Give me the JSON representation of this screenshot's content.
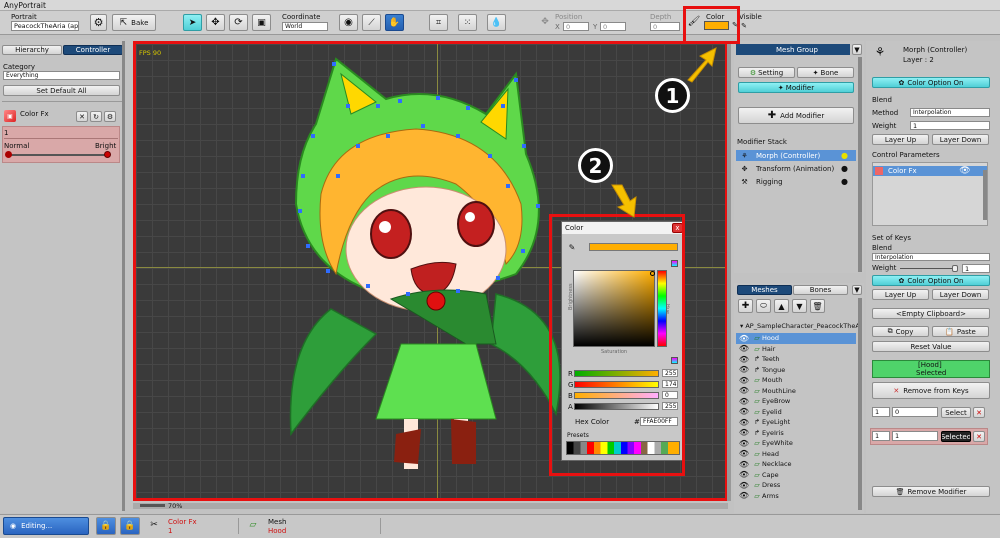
{
  "window": {
    "title": "AnyPortrait"
  },
  "toolbar": {
    "portrait_label": "Portrait",
    "portrait_value": "PeacockTheAria (ap",
    "bake_label": "Bake",
    "coordinate_label": "Coordinate",
    "coordinate_value": "World",
    "position_label": "Position",
    "pos_x_label": "X",
    "pos_x": "0",
    "pos_y_label": "Y",
    "pos_y": "0",
    "depth_label": "Depth",
    "depth_value": "0",
    "color_label": "Color",
    "visible_label": "Visible"
  },
  "left": {
    "tabs": [
      "Hierarchy",
      "Controller"
    ],
    "category_label": "Category",
    "category_value": "Everything",
    "set_default_label": "Set Default All",
    "control_name": "Color Fx",
    "control_value": "1",
    "slider_min_label": "Normal",
    "slider_max_label": "Bright"
  },
  "viewport": {
    "fps": "FPS 90",
    "zoom": "70%"
  },
  "color_picker": {
    "title": "Color",
    "close": "x",
    "brightness_label": "Brightness",
    "saturation_label": "Saturation",
    "hue_label": "Hue",
    "channels": [
      {
        "name": "R",
        "value": "255",
        "color": "#e03020"
      },
      {
        "name": "G",
        "value": "174",
        "color": "#30c030"
      },
      {
        "name": "B",
        "value": "0",
        "color": "#3050e0"
      },
      {
        "name": "A",
        "value": "255",
        "color": "#606060"
      }
    ],
    "hex_label": "Hex Color",
    "hex_hash": "#",
    "hex_value": "FFAE00FF",
    "presets_label": "Presets",
    "swatch_color": "#ffae00"
  },
  "mesh_group": {
    "header": "Mesh Group",
    "setting_label": "Setting",
    "bone_label": "Bone",
    "modifier_label": "Modifier",
    "add_modifier_label": "Add Modifier",
    "stack_label": "Modifier Stack",
    "stack": [
      {
        "label": "Morph (Controller)",
        "selected": true
      },
      {
        "label": "Transform (Animation)",
        "selected": false
      },
      {
        "label": "Rigging",
        "selected": false
      }
    ]
  },
  "meshes": {
    "tabs": [
      "Meshes",
      "Bones"
    ],
    "root": "AP_SampleCharacter_PeacockTheA",
    "items": [
      "Hood",
      "Hair",
      "Teeth",
      "Tongue",
      "Mouth",
      "MouthLine",
      "EyeBrow",
      "Eyelid",
      "EyeLight",
      "EyeIris",
      "EyeWhite",
      "Head",
      "Necklace",
      "Cape",
      "Dress",
      "Arms"
    ]
  },
  "right": {
    "title": "Morph (Controller)",
    "layer": "Layer : 2",
    "color_option_label": "Color Option On",
    "blend_label": "Blend",
    "method_label": "Method",
    "method_value": "Interpolation",
    "weight_label": "Weight",
    "weight_value": "1",
    "layer_up_label": "Layer Up",
    "layer_down_label": "Layer Down",
    "control_params_label": "Control Parameters",
    "param_item": "Color Fx",
    "set_of_keys_label": "Set of Keys",
    "blend2_label": "Blend",
    "blend2_value": "Interpolation",
    "weight2_label": "Weight",
    "weight2_value": "1",
    "color_option2_label": "Color Option On",
    "layer_up2_label": "Layer Up",
    "layer_down2_label": "Layer Down",
    "clipboard_label": "<Empty Clipboard>",
    "copy_label": "Copy",
    "paste_label": "Paste",
    "reset_label": "Reset Value",
    "selected_line1": "[Hood]",
    "selected_line2": "Selected",
    "remove_keys_label": "Remove from Keys",
    "key1_left": "1",
    "key1_right": "0",
    "select_label": "Select",
    "key2_left": "1",
    "key2_right": "1",
    "selected_btn_label": "Selected",
    "remove_modifier_label": "Remove Modifier"
  },
  "status": {
    "editing_label": "Editing...",
    "param_name": "Color Fx",
    "param_value": "1",
    "mesh_label": "Mesh",
    "mesh_value": "Hood"
  },
  "annotations": {
    "one": "1",
    "two": "2"
  }
}
